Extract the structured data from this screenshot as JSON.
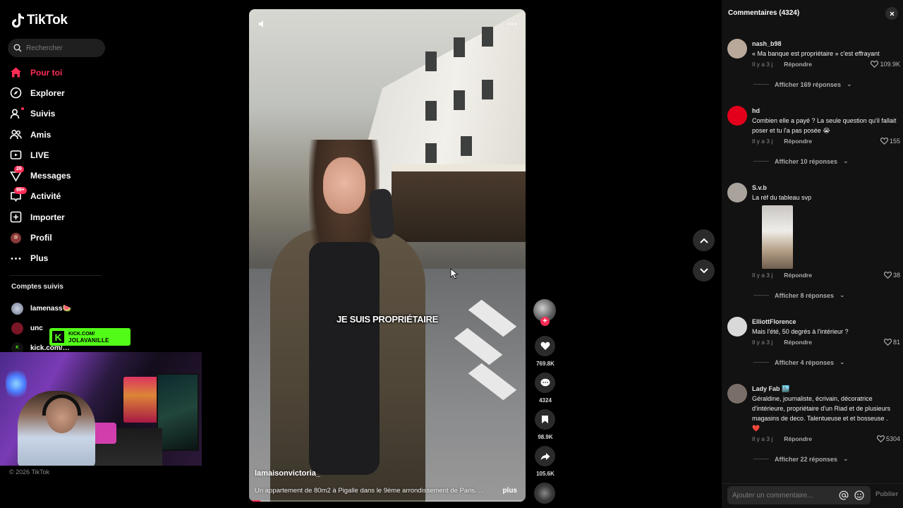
{
  "app": {
    "name": "TikTok",
    "copyright": "© 2026 TikTok"
  },
  "search": {
    "placeholder": "Rechercher"
  },
  "nav": {
    "items": [
      {
        "label": "Pour toi",
        "icon": "home-icon",
        "active": true
      },
      {
        "label": "Explorer",
        "icon": "compass-icon"
      },
      {
        "label": "Suivis",
        "icon": "following-icon"
      },
      {
        "label": "Amis",
        "icon": "friends-icon"
      },
      {
        "label": "LIVE",
        "icon": "live-icon"
      },
      {
        "label": "Messages",
        "icon": "messages-icon",
        "badge": "26"
      },
      {
        "label": "Activité",
        "icon": "activity-icon",
        "badge": "99+"
      },
      {
        "label": "Importer",
        "icon": "upload-icon"
      },
      {
        "label": "Profil",
        "icon": "profile-icon"
      },
      {
        "label": "Plus",
        "icon": "more-icon"
      }
    ]
  },
  "followed": {
    "title": "Comptes suivis",
    "accounts": [
      {
        "name": "lamenass🍉"
      },
      {
        "name": "unc"
      },
      {
        "name": "kick.com/…"
      }
    ]
  },
  "overlay": {
    "kick_line1": "KICK.COM/",
    "kick_line2": "JOLAVANILLE"
  },
  "video": {
    "subtitle": "JE SUIS PROPRIÉTAIRE",
    "username": "lamaisonvictoria_",
    "description": "Un appartement de 80m2 à Pigalle dans le 9ème arrondissement de Paris. ...",
    "more_label": "plus",
    "progress": 0.04
  },
  "actions": {
    "likes": "769.8K",
    "comments": "4324",
    "saves": "98.9K",
    "shares": "105.6K"
  },
  "comments": {
    "header": "Commentaires (4324)",
    "input_placeholder": "Ajouter un commentaire...",
    "publish_label": "Publier",
    "reply_label": "Répondre",
    "items": [
      {
        "user": "nash_b98",
        "text": "« Ma banque est propriétaire » c'est effrayant",
        "time": "Il y a 3 j",
        "likes": "109.9K",
        "replies": "Afficher 169 réponses",
        "avatar_color": "#b9a99a"
      },
      {
        "user": "hd",
        "text": "Combien elle a payé ? La seule question qu'il fallait poser et tu l'a pas posée 😭",
        "time": "Il y a 3 j",
        "likes": "155",
        "replies": "Afficher 10 réponses",
        "avatar_color": "#e3001b"
      },
      {
        "user": "S.v.b",
        "text": "La réf du tableau svp",
        "time": "Il y a 3 j",
        "likes": "38",
        "replies": "Afficher 8 réponses",
        "avatar_color": "#a9a39c"
      },
      {
        "user": "ElliottFlorence",
        "text": "Mais l'été, 50 degrés à l'intérieur ?",
        "time": "Il y a 3 j",
        "likes": "81",
        "replies": "Afficher 4 réponses",
        "avatar_color": "#d9d9d9"
      },
      {
        "user": "Lady Fab 🏙️",
        "text": "Géraldine, journaliste, écrivain, décoratrice d'intérieure, propriétaire d'un Riad et de plusieurs magasins de deco. Talentueuse et et bosseuse . ❤️",
        "time": "Il y a 3 j",
        "likes": "5304",
        "replies": "Afficher 22 réponses",
        "avatar_color": "#7a6e68"
      }
    ]
  }
}
